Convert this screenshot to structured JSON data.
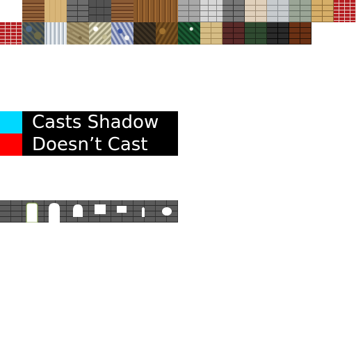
{
  "tileset": {
    "row1": [
      "wood-planks-horizontal",
      "sand-stone",
      "grey-brick",
      "dark-stone",
      "wood-planks-horizontal",
      "wood-planks-vertical",
      "wood-planks-vertical",
      "light-grey-brick",
      "white-stone",
      "grey-block",
      "beige-brick",
      "silver-brick",
      "green-grey-brick",
      "tan-brick",
      "red-brick"
    ],
    "row2": [
      "red-brick",
      "mixed-rock",
      "ice-crystal",
      "gravel",
      "pebble",
      "blue-pebble",
      "dark-mud",
      "brown-rock",
      "green-moss",
      "wheat-brick",
      "maroon-brick",
      "dark-green-brick",
      "black-brick",
      "rust-brick"
    ]
  },
  "legend": {
    "casts_shadow_color": "#00d8ff",
    "casts_shadow_label": "Casts Shadow",
    "doesnt_cast_color": "#ff0000",
    "doesnt_cast_label": "Doesn’t Cast"
  },
  "openings": [
    "door-arch",
    "door-arch",
    "window-arch",
    "window-square",
    "window-small",
    "window-slit",
    "window-round"
  ]
}
